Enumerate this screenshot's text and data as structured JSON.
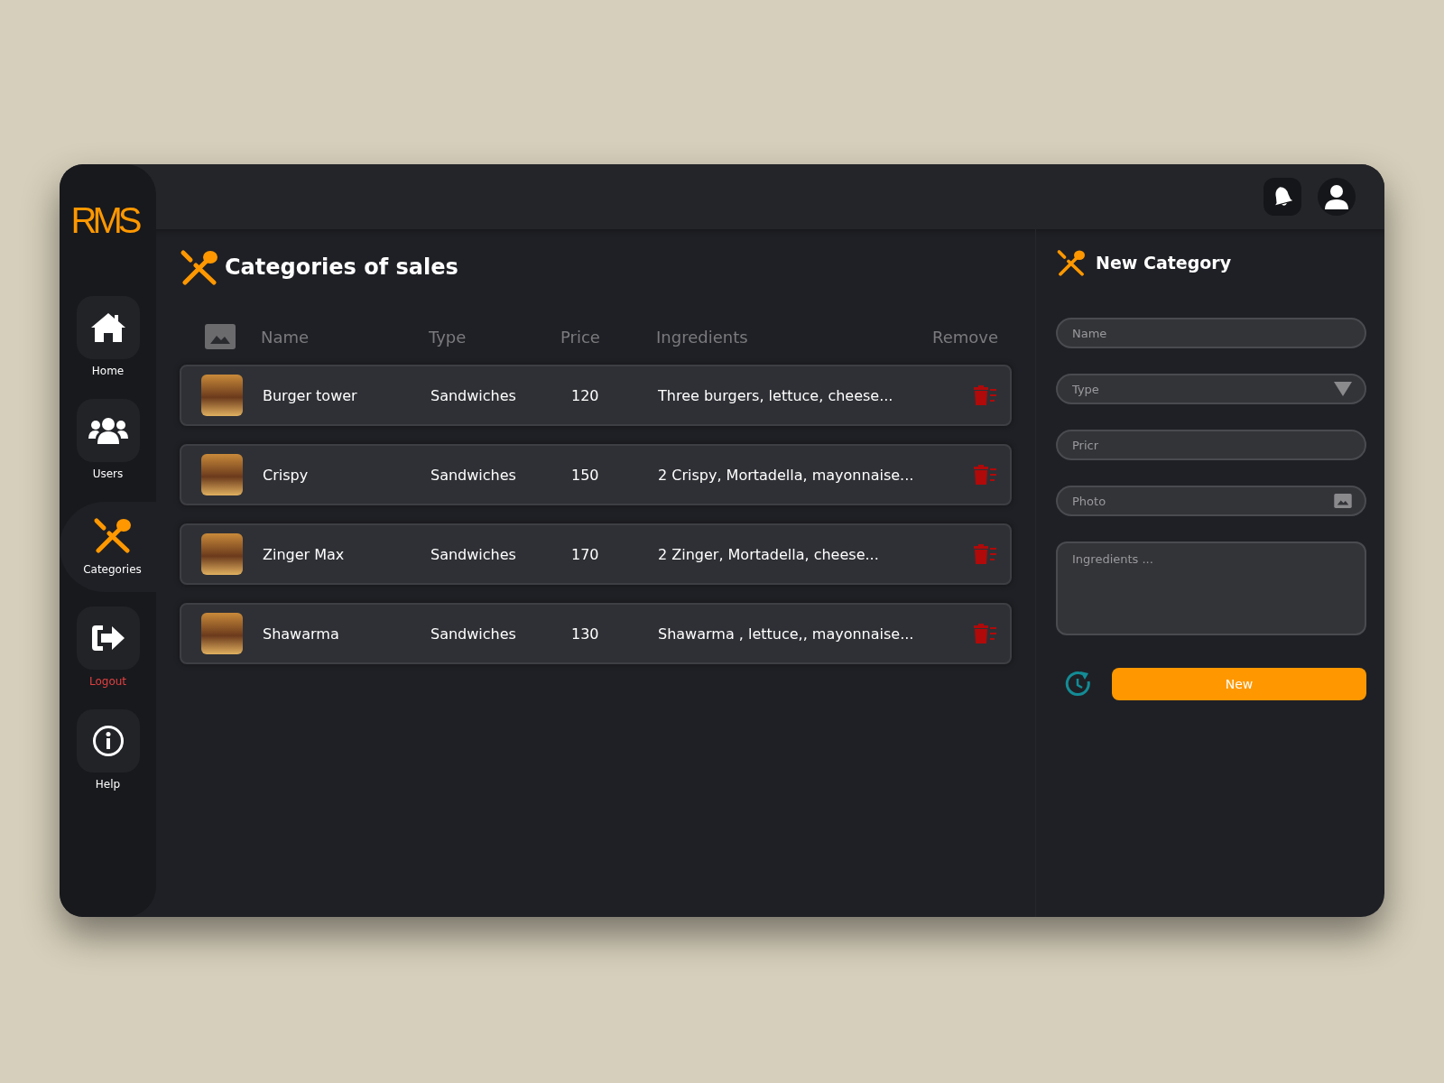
{
  "logo": {
    "text": "RMS"
  },
  "sidebar": {
    "items": [
      {
        "label": "Home",
        "kind": "home",
        "selected": false,
        "danger": false
      },
      {
        "label": "Users",
        "kind": "users",
        "selected": false,
        "danger": false
      },
      {
        "label": "Categories",
        "kind": "categories",
        "selected": true,
        "danger": false
      },
      {
        "label": "Logout",
        "kind": "logout",
        "selected": false,
        "danger": true
      },
      {
        "label": "Help",
        "kind": "help",
        "selected": false,
        "danger": false
      }
    ]
  },
  "main": {
    "title": "Categories of sales",
    "table": {
      "columns": [
        "Name",
        "Type",
        "Price",
        "Ingredients",
        "Remove"
      ],
      "rows": [
        {
          "name": "Burger tower",
          "type": "Sandwiches",
          "price": "120",
          "ingredients": "Three burgers, lettuce, cheese..."
        },
        {
          "name": "Crispy",
          "type": "Sandwiches",
          "price": "150",
          "ingredients": "2 Crispy, Mortadella, mayonnaise..."
        },
        {
          "name": "Zinger Max",
          "type": "Sandwiches",
          "price": "170",
          "ingredients": "2 Zinger, Mortadella, cheese..."
        },
        {
          "name": "Shawarma",
          "type": "Sandwiches",
          "price": "130",
          "ingredients": "Shawarma , lettuce,, mayonnaise..."
        }
      ]
    }
  },
  "form": {
    "title": "New Category",
    "fields": [
      {
        "placeholder": "Name",
        "kind": "text"
      },
      {
        "placeholder": "Type",
        "kind": "select"
      },
      {
        "placeholder": "Pricr",
        "kind": "text"
      },
      {
        "placeholder": "Photo",
        "kind": "photo"
      },
      {
        "placeholder": "Ingredients ...",
        "kind": "textarea"
      }
    ],
    "submit": "New"
  }
}
